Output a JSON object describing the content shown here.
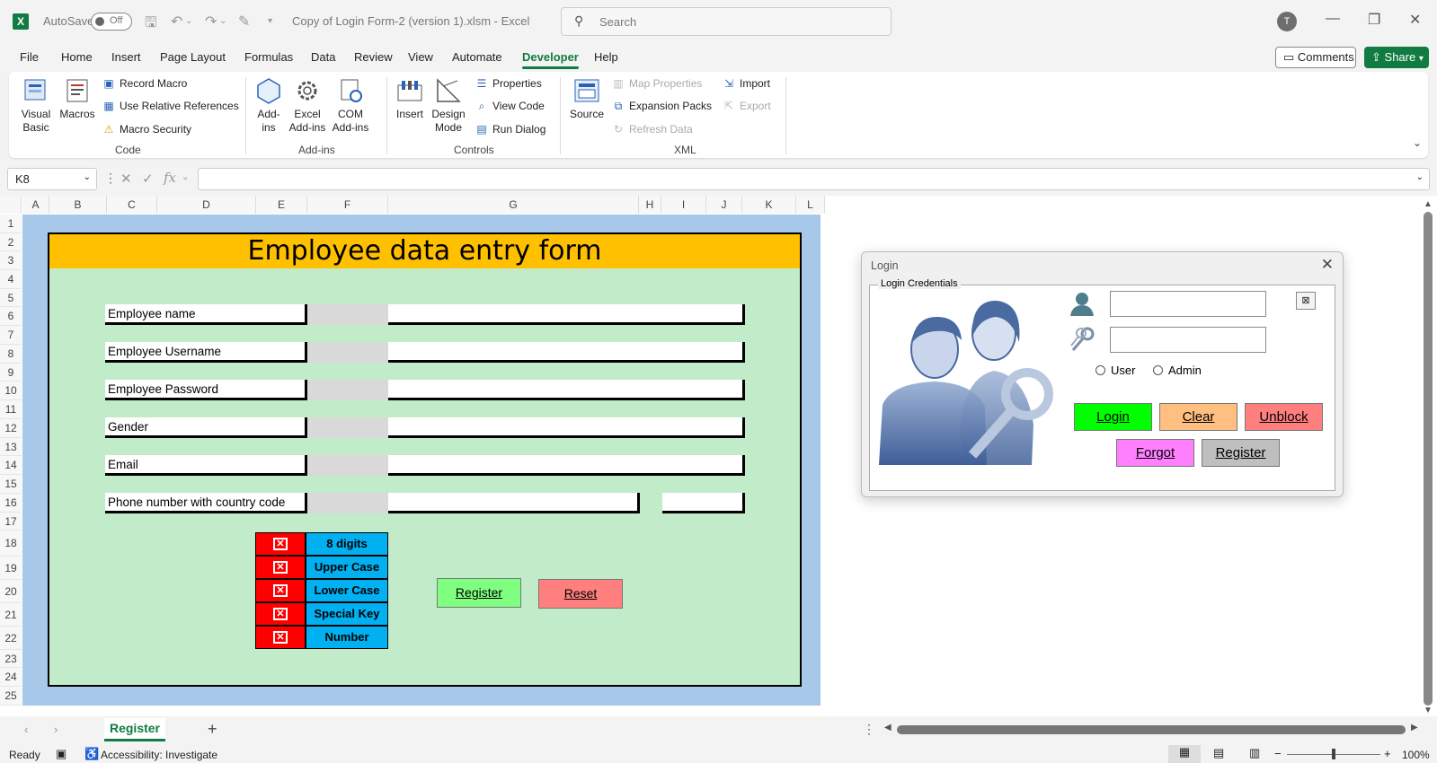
{
  "titlebar": {
    "autosave_label": "AutoSave",
    "autosave_state": "Off",
    "file_title": "Copy of Login Form-2 (version 1).xlsm  -  Excel",
    "search_placeholder": "Search",
    "user_initial": "T"
  },
  "ribbon_tabs": [
    "File",
    "Home",
    "Insert",
    "Page Layout",
    "Formulas",
    "Data",
    "Review",
    "View",
    "Automate",
    "Developer",
    "Help"
  ],
  "active_tab": "Developer",
  "share": {
    "comments_label": "Comments",
    "share_label": "Share"
  },
  "ribbon": {
    "code": {
      "label": "Code",
      "visual_basic": "Visual Basic",
      "macros": "Macros",
      "record_macro": "Record Macro",
      "relative_refs": "Use Relative References",
      "macro_security": "Macro Security"
    },
    "addins": {
      "label": "Add-ins",
      "addins": "Add-ins",
      "excel_addins": "Excel Add-ins",
      "com_addins": "COM Add-ins"
    },
    "controls": {
      "label": "Controls",
      "insert": "Insert",
      "design_mode": "Design Mode",
      "properties": "Properties",
      "view_code": "View Code",
      "run_dialog": "Run Dialog"
    },
    "xml": {
      "label": "XML",
      "source": "Source",
      "map_properties": "Map Properties",
      "expansion_packs": "Expansion Packs",
      "refresh_data": "Refresh Data",
      "import": "Import",
      "export": "Export"
    }
  },
  "formula_bar": {
    "cell_ref": "K8",
    "fx": "fx",
    "value": ""
  },
  "columns": [
    "A",
    "B",
    "C",
    "D",
    "E",
    "F",
    "G",
    "H",
    "I",
    "J",
    "K",
    "L"
  ],
  "rows": [
    "1",
    "2",
    "3",
    "4",
    "5",
    "6",
    "7",
    "8",
    "9",
    "10",
    "11",
    "12",
    "13",
    "14",
    "15",
    "16",
    "17",
    "18",
    "19",
    "20",
    "21",
    "22",
    "23",
    "24",
    "25"
  ],
  "form": {
    "title": "Employee data entry form",
    "fields": [
      "Employee name",
      "Employee Username",
      "Employee Password",
      "Gender",
      "Email",
      "Phone number with country code"
    ],
    "password_rules": [
      "8 digits",
      "Upper Case",
      "Lower Case",
      "Special Key",
      "Number"
    ],
    "register_button": "Register",
    "reset_button": "Reset"
  },
  "login_dialog": {
    "title": "Login",
    "frame_label": "Login Credentials",
    "username_value": "",
    "password_value": "",
    "role_user": "User",
    "role_admin": "Admin",
    "login_button": "Login",
    "clear_button": "Clear",
    "unblock_button": "Unblock",
    "forgot_button": "Forgot",
    "register_button": "Register",
    "colors": {
      "login": "#00ff00",
      "clear": "#ffbf80",
      "unblock": "#ff7f7f",
      "forgot": "#ff80ff",
      "register": "#bfbfbf"
    }
  },
  "sheet_tabs": [
    "Register"
  ],
  "status": {
    "ready": "Ready",
    "accessibility": "Accessibility: Investigate",
    "zoom": "100%"
  }
}
